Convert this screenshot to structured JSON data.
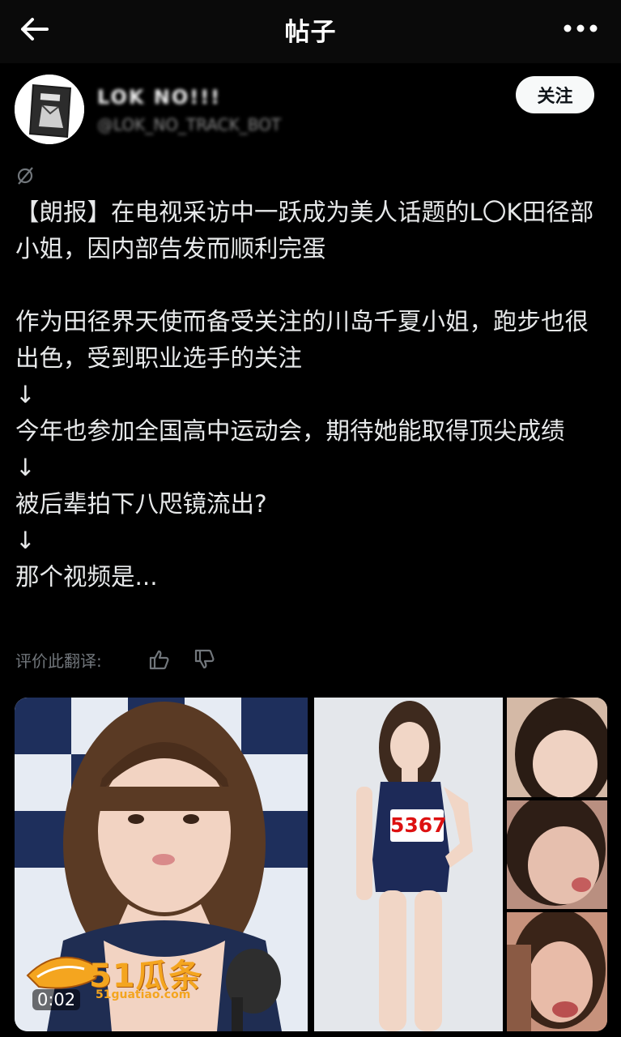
{
  "header": {
    "title": "帖子",
    "back_icon": "arrow-left-icon",
    "more_icon": "more-horizontal-icon"
  },
  "author": {
    "name": "LOK NO!!!",
    "handle": "@LOK_NO_TRACK_BOT",
    "follow_label": "关注"
  },
  "post": {
    "lines": [
      "【朗报】在电视采访中一跃成为美人话题的L〇K田径部小姐，因内部告发而顺利完蛋",
      "",
      "作为田径界天使而备受关注的川岛千夏小姐，跑步也很出色，受到职业选手的关注",
      "↓",
      "今年也参加全国高中运动会，期待她能取得顶尖成绩",
      "↓",
      "被后辈拍下八咫镜流出?",
      "↓",
      "那个视频是..."
    ]
  },
  "rating": {
    "label": "评价此翻译:"
  },
  "media": {
    "video_time": "0:02",
    "watermark": "51瓜条",
    "watermark_site": "51guatiao.com",
    "bib_number": "5367"
  },
  "colors": {
    "background": "#000000",
    "text": "#e7e9ea",
    "muted": "#71767b",
    "watermark": "#f4a51f"
  }
}
